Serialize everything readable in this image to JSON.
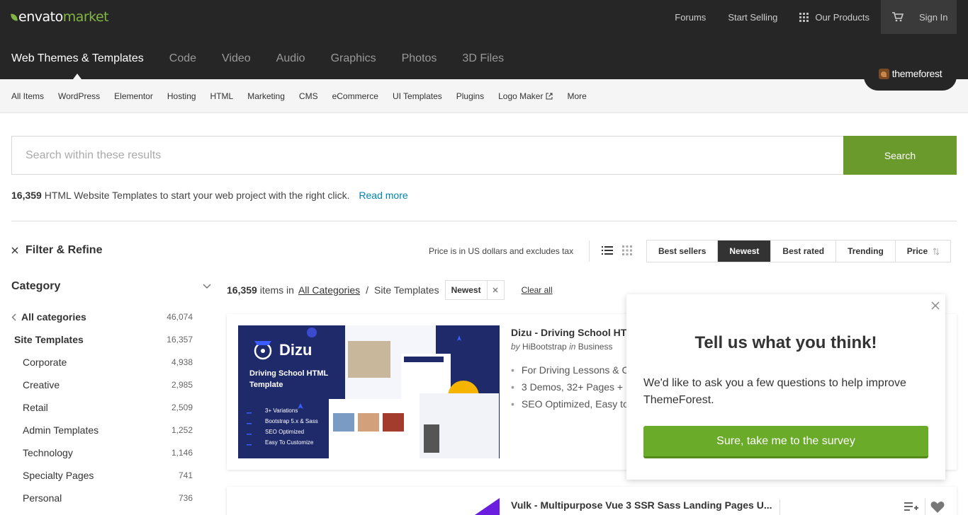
{
  "header": {
    "logo_envato": "envato",
    "logo_market": "market",
    "links": [
      "Forums",
      "Start Selling",
      "Our Products"
    ],
    "sign_in": "Sign In",
    "main_nav": [
      "Web Themes & Templates",
      "Code",
      "Video",
      "Audio",
      "Graphics",
      "Photos",
      "3D Files"
    ],
    "brand_badge": "themeforest"
  },
  "subnav": [
    "All Items",
    "WordPress",
    "Elementor",
    "Hosting",
    "HTML",
    "Marketing",
    "CMS",
    "eCommerce",
    "UI Templates",
    "Plugins",
    "Logo Maker",
    "More"
  ],
  "search": {
    "placeholder": "Search within these results",
    "button": "Search"
  },
  "intro": {
    "count": "16,359",
    "text": "HTML Website Templates to start your web project with the right click.",
    "read_more": "Read more"
  },
  "filter": {
    "title": "Filter & Refine",
    "price_note": "Price is in US dollars and excludes tax",
    "sort_options": [
      "Best sellers",
      "Newest",
      "Best rated",
      "Trending",
      "Price"
    ],
    "active_sort": "Newest"
  },
  "category": {
    "title": "Category",
    "all": {
      "label": "All categories",
      "count": "46,074"
    },
    "current": {
      "label": "Site Templates",
      "count": "16,357"
    },
    "items": [
      {
        "label": "Corporate",
        "count": "4,938"
      },
      {
        "label": "Creative",
        "count": "2,985"
      },
      {
        "label": "Retail",
        "count": "2,509"
      },
      {
        "label": "Admin Templates",
        "count": "1,252"
      },
      {
        "label": "Technology",
        "count": "1,146"
      },
      {
        "label": "Specialty Pages",
        "count": "741"
      },
      {
        "label": "Personal",
        "count": "736"
      }
    ]
  },
  "results": {
    "count": "16,359",
    "items_in": "items in",
    "crumb_all": "All Categories",
    "crumb_current": "Site Templates",
    "chip": "Newest",
    "clear_all": "Clear all"
  },
  "items": [
    {
      "title": "Dizu - Driving School HTML",
      "by": "by",
      "author": "HiBootstrap",
      "in": "in",
      "category": "Business",
      "features": [
        "For Driving Lessons & C",
        "3 Demos, 32+ Pages + E",
        "SEO Optimized, Easy to"
      ],
      "thumb": {
        "brand": "Dizu",
        "headline": "Driving School HTML Template",
        "bullets": [
          "3+ Variations",
          "Bootstrap 5.x & Sass",
          "SEO Optimized",
          "Easy To Customize"
        ]
      }
    },
    {
      "title": "Vulk - Multipurpose Vue 3 SSR Sass Landing Pages U..."
    }
  ],
  "survey": {
    "title": "Tell us what you think!",
    "body": "We'd like to ask you a few questions to help improve ThemeForest.",
    "button": "Sure, take me to the survey"
  },
  "colors": {
    "header_bg": "#262626",
    "accent_green": "#82b541",
    "search_green": "#6b9a2c",
    "link_blue": "#0084b4",
    "thumb_navy": "#1f2a6a"
  }
}
